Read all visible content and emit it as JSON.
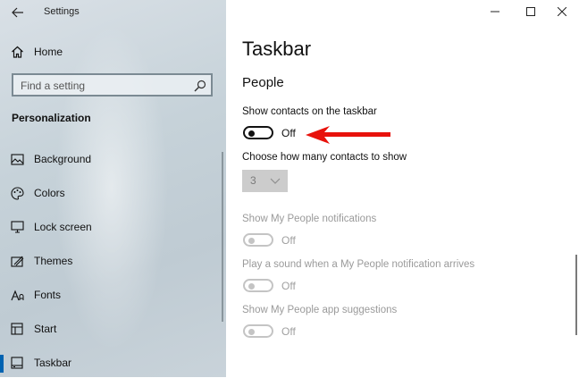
{
  "window": {
    "title": "Settings"
  },
  "sidebar": {
    "home_label": "Home",
    "search_placeholder": "Find a setting",
    "section_title": "Personalization",
    "items": [
      {
        "label": "Background",
        "icon": "image-icon"
      },
      {
        "label": "Colors",
        "icon": "palette-icon"
      },
      {
        "label": "Lock screen",
        "icon": "lock-screen-icon"
      },
      {
        "label": "Themes",
        "icon": "themes-icon"
      },
      {
        "label": "Fonts",
        "icon": "fonts-icon"
      },
      {
        "label": "Start",
        "icon": "start-icon"
      },
      {
        "label": "Taskbar",
        "icon": "taskbar-icon"
      }
    ],
    "active_item": "Taskbar"
  },
  "main": {
    "page_title": "Taskbar",
    "section_title": "People",
    "settings": [
      {
        "label": "Show contacts on the taskbar",
        "state": "Off",
        "enabled": true
      },
      {
        "label": "Show My People notifications",
        "state": "Off",
        "enabled": false
      },
      {
        "label": "Play a sound when a My People notification arrives",
        "state": "Off",
        "enabled": false
      },
      {
        "label": "Show My People app suggestions",
        "state": "Off",
        "enabled": false
      }
    ],
    "contacts_count": {
      "label": "Choose how many contacts to show",
      "value": "3",
      "enabled": false
    }
  },
  "colors": {
    "accent": "#0063b1",
    "annotation_arrow": "#e8120c"
  }
}
